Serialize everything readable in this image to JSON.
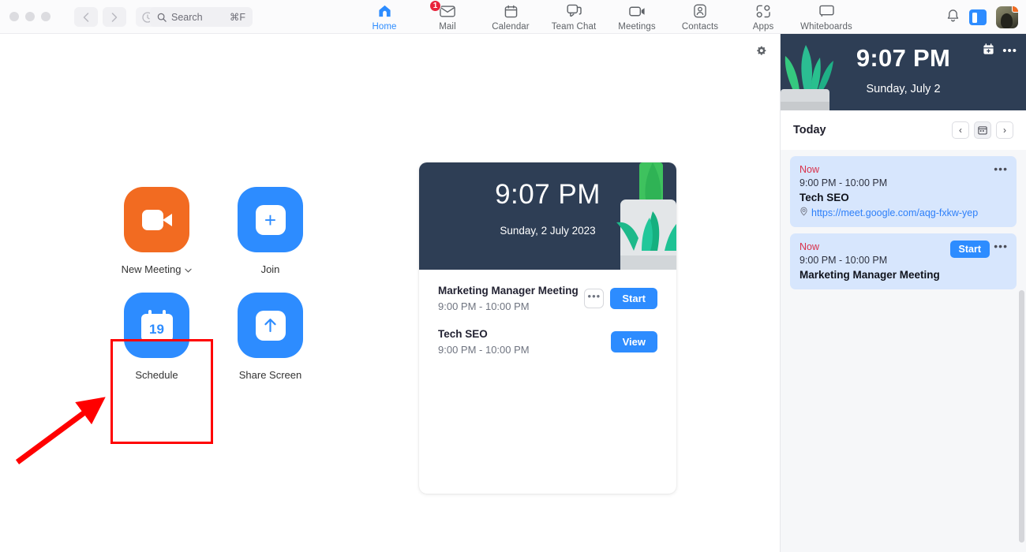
{
  "window": {
    "traffic_lights": [
      "close",
      "minimize",
      "maximize"
    ],
    "nav": {
      "back": "back-chevron",
      "forward": "forward-chevron",
      "history": "history-icon"
    }
  },
  "search": {
    "placeholder": "Search",
    "value": "Search",
    "shortcut": "⌘F",
    "icon": "search-icon"
  },
  "tabs": [
    {
      "label": "Home",
      "icon": "home-icon",
      "active": true,
      "badge": ""
    },
    {
      "label": "Mail",
      "icon": "mail-icon",
      "active": false,
      "badge": "1"
    },
    {
      "label": "Calendar",
      "icon": "calendar-icon",
      "active": false,
      "badge": ""
    },
    {
      "label": "Team Chat",
      "icon": "chat-bubbles-icon",
      "active": false,
      "badge": ""
    },
    {
      "label": "Meetings",
      "icon": "video-camera-icon",
      "active": false,
      "badge": ""
    },
    {
      "label": "Contacts",
      "icon": "person-icon",
      "active": false,
      "badge": ""
    },
    {
      "label": "Apps",
      "icon": "apps-icon",
      "active": false,
      "badge": ""
    },
    {
      "label": "Whiteboards",
      "icon": "whiteboard-icon",
      "active": false,
      "badge": ""
    }
  ],
  "header_right": {
    "notifications_icon": "bell-icon",
    "panel_toggle_icon": "side-panel-icon",
    "avatar": "user-avatar",
    "presence": "away-status"
  },
  "main": {
    "settings_icon": "gear-icon",
    "actions": [
      {
        "label": "New Meeting",
        "icon": "video-camera-icon",
        "color": "#f26b21",
        "has_caret": true
      },
      {
        "label": "Join",
        "icon": "plus-icon",
        "color": "#2d8cff",
        "has_caret": false
      },
      {
        "label": "Schedule",
        "icon": "calendar-19-icon",
        "color": "#2d8cff",
        "has_caret": false,
        "day": "19",
        "highlighted": true
      },
      {
        "label": "Share Screen",
        "icon": "up-arrow-icon",
        "color": "#2d8cff",
        "has_caret": false
      }
    ],
    "annotation": {
      "type": "red-arrow",
      "target": "Schedule",
      "box_color": "#ff0000"
    }
  },
  "meeting_card": {
    "time": "9:07 PM",
    "date": "Sunday, 2 July 2023",
    "meetings": [
      {
        "title": "Marketing Manager Meeting",
        "time": "9:00 PM - 10:00 PM",
        "more_label": "•••",
        "action_label": "Start"
      },
      {
        "title": "Tech SEO",
        "time": "9:00 PM - 10:00 PM",
        "more_label": "",
        "action_label": "View"
      }
    ]
  },
  "sidebar": {
    "time": "9:07 PM",
    "date": "Sunday, July 2",
    "add_event_icon": "calendar-add-icon",
    "more_icon": "more-horizontal-icon",
    "section_label": "Today",
    "nav": {
      "prev": "‹",
      "calendar": "calendar-icon",
      "next": "›"
    },
    "events": [
      {
        "status": "Now",
        "time": "9:00 PM - 10:00 PM",
        "title": "Tech SEO",
        "link": "https://meet.google.com/aqg-fxkw-yep",
        "link_icon": "location-pin-icon",
        "start_label": "",
        "more_label": "•••"
      },
      {
        "status": "Now",
        "time": "9:00 PM - 10:00 PM",
        "title": "Marketing Manager Meeting",
        "link": "",
        "link_icon": "",
        "start_label": "Start",
        "more_label": "•••"
      }
    ]
  },
  "colors": {
    "accent": "#2d8cff",
    "orange": "#f26b21",
    "hero": "#2e3e55",
    "now": "#d9304a",
    "event_card": "#d7e6fd",
    "annotation": "#ff0000"
  }
}
